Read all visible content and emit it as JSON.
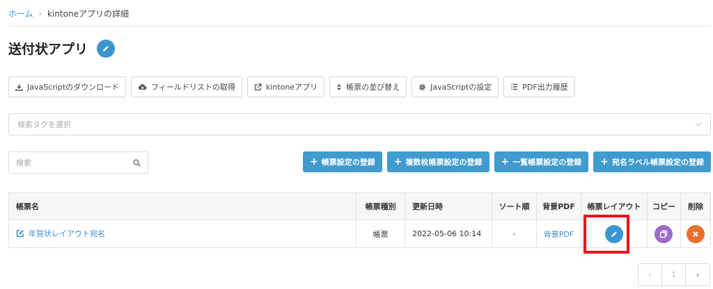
{
  "breadcrumb": {
    "home": "ホーム",
    "separator": "›",
    "current": "kintoneアプリの詳細"
  },
  "page": {
    "title": "送付状アプリ"
  },
  "toolbar": [
    {
      "label": "JavaScriptのダウンロード",
      "icon": "download-icon"
    },
    {
      "label": "フィールドリストの取得",
      "icon": "cloud-download-icon"
    },
    {
      "label": "kintoneアプリ",
      "icon": "external-link-icon"
    },
    {
      "label": "帳票の並び替え",
      "icon": "sort-icon"
    },
    {
      "label": "JavaScriptの設定",
      "icon": "gear-icon"
    },
    {
      "label": "PDF出力履歴",
      "icon": "list-icon"
    }
  ],
  "tag_select": {
    "placeholder": "検索タグを選択"
  },
  "search": {
    "placeholder": "検索"
  },
  "actions": [
    {
      "label": "帳票設定の登録"
    },
    {
      "label": "複数枚帳票設定の登録"
    },
    {
      "label": "一覧帳票設定の登録"
    },
    {
      "label": "宛名ラベル帳票設定の登録"
    }
  ],
  "table": {
    "headers": [
      "帳票名",
      "帳票種別",
      "更新日時",
      "ソート順",
      "背景PDF",
      "帳票レイアウト",
      "コピー",
      "削除"
    ],
    "rows": [
      {
        "name": "年賀状レイアウト宛名",
        "type": "帳票",
        "updated": "2022-05-06 10:14",
        "sort": "-",
        "bg_pdf": "背景PDF"
      }
    ]
  },
  "pagination": {
    "prev": "‹",
    "page": "1",
    "next": "›"
  },
  "colors": {
    "accent": "#3f9bd0",
    "edit": "#3a95d1",
    "copy": "#9b6bc9",
    "delete": "#e7702f",
    "highlight": "#e8141b"
  }
}
